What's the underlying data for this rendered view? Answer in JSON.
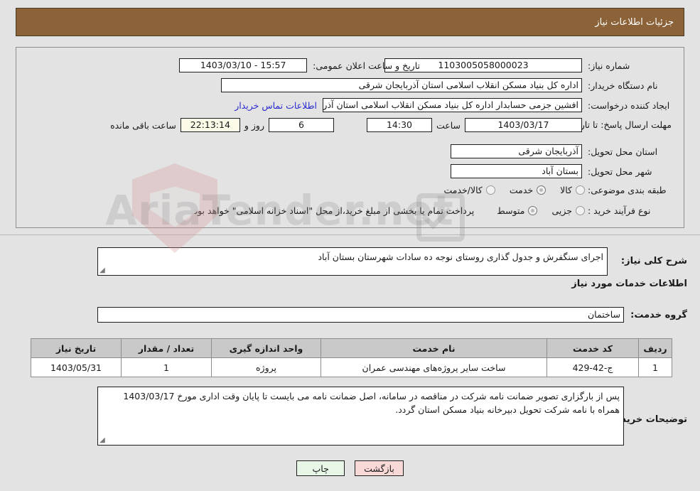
{
  "header": {
    "title": "جزئیات اطلاعات نیاز"
  },
  "watermark": {
    "text": "AriaTender.net"
  },
  "colors": {
    "header_bg": "#8c6239",
    "header_text": "#ffffff",
    "page_bg": "#e3e3e3",
    "link": "#2a2ad0",
    "timer_bg": "#fbfbe8",
    "table_header_bg": "#c9c9c9",
    "btn_print_bg": "#e8f6e8",
    "btn_back_bg": "#f9d8d8"
  },
  "form": {
    "need_number_label": "شماره نیاز:",
    "need_number_value": "1103005058000023",
    "announce_datetime_label": "تاریخ و ساعت اعلان عمومی:",
    "announce_datetime_value": "15:57 - 1403/03/10",
    "buyer_org_label": "نام دستگاه خریدار:",
    "buyer_org_value": "اداره کل بنیاد مسکن انقلاب اسلامی استان آذربایجان شرقی",
    "creator_label": "ایجاد کننده درخواست:",
    "creator_value": "افشین جزمی حسابدار اداره کل بنیاد مسکن انقلاب اسلامی استان آذربایجان ش",
    "contact_link": "اطلاعات تماس خریدار",
    "deadline_label": "مهلت ارسال پاسخ: تا تاریخ:",
    "deadline_date": "1403/03/17",
    "deadline_hour_label": "ساعت",
    "deadline_hour_value": "14:30",
    "days_value": "6",
    "days_label": "روز و",
    "countdown_value": "22:13:14",
    "countdown_label": "ساعت باقی مانده",
    "province_label": "استان محل تحویل:",
    "province_value": "آذربایجان شرقی",
    "city_label": "شهر محل تحویل:",
    "city_value": "بستان آباد",
    "category_label": "طبقه بندی موضوعی:",
    "category_options": [
      {
        "label": "کالا",
        "selected": false
      },
      {
        "label": "خدمت",
        "selected": true
      },
      {
        "label": "کالا/خدمت",
        "selected": false
      }
    ],
    "process_label": "نوع فرآیند خرید :",
    "process_options": [
      {
        "label": "جزیی",
        "selected": false
      },
      {
        "label": "متوسط",
        "selected": true
      }
    ],
    "process_note": "پرداخت تمام یا بخشی از مبلغ خرید،از محل \"اسناد خزانه اسلامی\" خواهد بود."
  },
  "summary": {
    "label": "شرح کلی نیاز:",
    "value": "اجرای سنگفرش و جدول گذاری  روستای نوجه ده سادات شهرستان بستان آباد"
  },
  "services_section": {
    "title": "اطلاعات خدمات مورد نیاز",
    "group_label": "گروه خدمت:",
    "group_value": "ساختمان"
  },
  "table": {
    "columns": [
      "ردیف",
      "کد خدمت",
      "نام خدمت",
      "واحد اندازه گیری",
      "تعداد / مقدار",
      "تاریخ نیاز"
    ],
    "rows": [
      [
        "1",
        "ج-42-429",
        "ساخت سایر پروژه‌های مهندسی عمران",
        "پروژه",
        "1",
        "1403/05/31"
      ]
    ]
  },
  "buyer_notes": {
    "label": "توضیحات خریدار:",
    "value": "پس از بارگزاری تصویر ضمانت نامه شرکت در مناقصه در سامانه، اصل ضمانت نامه می بایست تا پایان وقت اداری مورخ 1403/03/17 همراه با نامه شرکت تحویل دبیرخانه بنیاد مسکن استان گردد."
  },
  "buttons": {
    "print": "چاپ",
    "back": "بازگشت"
  }
}
